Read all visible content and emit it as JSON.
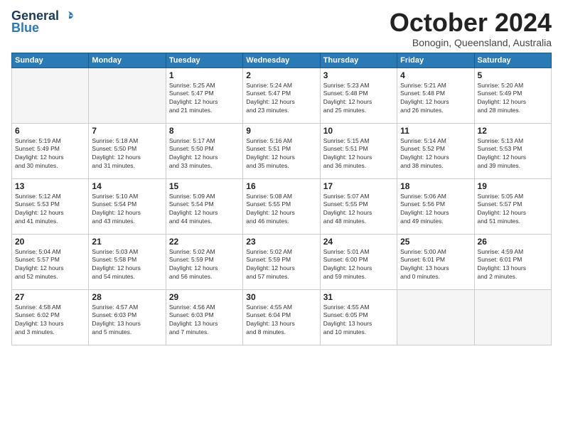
{
  "header": {
    "logo": {
      "general": "General",
      "blue": "Blue"
    },
    "title": "October 2024",
    "location": "Bonogin, Queensland, Australia"
  },
  "weekdays": [
    "Sunday",
    "Monday",
    "Tuesday",
    "Wednesday",
    "Thursday",
    "Friday",
    "Saturday"
  ],
  "weeks": [
    [
      {
        "day": "",
        "info": ""
      },
      {
        "day": "",
        "info": ""
      },
      {
        "day": "1",
        "info": "Sunrise: 5:25 AM\nSunset: 5:47 PM\nDaylight: 12 hours\nand 21 minutes."
      },
      {
        "day": "2",
        "info": "Sunrise: 5:24 AM\nSunset: 5:47 PM\nDaylight: 12 hours\nand 23 minutes."
      },
      {
        "day": "3",
        "info": "Sunrise: 5:23 AM\nSunset: 5:48 PM\nDaylight: 12 hours\nand 25 minutes."
      },
      {
        "day": "4",
        "info": "Sunrise: 5:21 AM\nSunset: 5:48 PM\nDaylight: 12 hours\nand 26 minutes."
      },
      {
        "day": "5",
        "info": "Sunrise: 5:20 AM\nSunset: 5:49 PM\nDaylight: 12 hours\nand 28 minutes."
      }
    ],
    [
      {
        "day": "6",
        "info": "Sunrise: 5:19 AM\nSunset: 5:49 PM\nDaylight: 12 hours\nand 30 minutes."
      },
      {
        "day": "7",
        "info": "Sunrise: 5:18 AM\nSunset: 5:50 PM\nDaylight: 12 hours\nand 31 minutes."
      },
      {
        "day": "8",
        "info": "Sunrise: 5:17 AM\nSunset: 5:50 PM\nDaylight: 12 hours\nand 33 minutes."
      },
      {
        "day": "9",
        "info": "Sunrise: 5:16 AM\nSunset: 5:51 PM\nDaylight: 12 hours\nand 35 minutes."
      },
      {
        "day": "10",
        "info": "Sunrise: 5:15 AM\nSunset: 5:51 PM\nDaylight: 12 hours\nand 36 minutes."
      },
      {
        "day": "11",
        "info": "Sunrise: 5:14 AM\nSunset: 5:52 PM\nDaylight: 12 hours\nand 38 minutes."
      },
      {
        "day": "12",
        "info": "Sunrise: 5:13 AM\nSunset: 5:53 PM\nDaylight: 12 hours\nand 39 minutes."
      }
    ],
    [
      {
        "day": "13",
        "info": "Sunrise: 5:12 AM\nSunset: 5:53 PM\nDaylight: 12 hours\nand 41 minutes."
      },
      {
        "day": "14",
        "info": "Sunrise: 5:10 AM\nSunset: 5:54 PM\nDaylight: 12 hours\nand 43 minutes."
      },
      {
        "day": "15",
        "info": "Sunrise: 5:09 AM\nSunset: 5:54 PM\nDaylight: 12 hours\nand 44 minutes."
      },
      {
        "day": "16",
        "info": "Sunrise: 5:08 AM\nSunset: 5:55 PM\nDaylight: 12 hours\nand 46 minutes."
      },
      {
        "day": "17",
        "info": "Sunrise: 5:07 AM\nSunset: 5:55 PM\nDaylight: 12 hours\nand 48 minutes."
      },
      {
        "day": "18",
        "info": "Sunrise: 5:06 AM\nSunset: 5:56 PM\nDaylight: 12 hours\nand 49 minutes."
      },
      {
        "day": "19",
        "info": "Sunrise: 5:05 AM\nSunset: 5:57 PM\nDaylight: 12 hours\nand 51 minutes."
      }
    ],
    [
      {
        "day": "20",
        "info": "Sunrise: 5:04 AM\nSunset: 5:57 PM\nDaylight: 12 hours\nand 52 minutes."
      },
      {
        "day": "21",
        "info": "Sunrise: 5:03 AM\nSunset: 5:58 PM\nDaylight: 12 hours\nand 54 minutes."
      },
      {
        "day": "22",
        "info": "Sunrise: 5:02 AM\nSunset: 5:59 PM\nDaylight: 12 hours\nand 56 minutes."
      },
      {
        "day": "23",
        "info": "Sunrise: 5:02 AM\nSunset: 5:59 PM\nDaylight: 12 hours\nand 57 minutes."
      },
      {
        "day": "24",
        "info": "Sunrise: 5:01 AM\nSunset: 6:00 PM\nDaylight: 12 hours\nand 59 minutes."
      },
      {
        "day": "25",
        "info": "Sunrise: 5:00 AM\nSunset: 6:01 PM\nDaylight: 13 hours\nand 0 minutes."
      },
      {
        "day": "26",
        "info": "Sunrise: 4:59 AM\nSunset: 6:01 PM\nDaylight: 13 hours\nand 2 minutes."
      }
    ],
    [
      {
        "day": "27",
        "info": "Sunrise: 4:58 AM\nSunset: 6:02 PM\nDaylight: 13 hours\nand 3 minutes."
      },
      {
        "day": "28",
        "info": "Sunrise: 4:57 AM\nSunset: 6:03 PM\nDaylight: 13 hours\nand 5 minutes."
      },
      {
        "day": "29",
        "info": "Sunrise: 4:56 AM\nSunset: 6:03 PM\nDaylight: 13 hours\nand 7 minutes."
      },
      {
        "day": "30",
        "info": "Sunrise: 4:55 AM\nSunset: 6:04 PM\nDaylight: 13 hours\nand 8 minutes."
      },
      {
        "day": "31",
        "info": "Sunrise: 4:55 AM\nSunset: 6:05 PM\nDaylight: 13 hours\nand 10 minutes."
      },
      {
        "day": "",
        "info": ""
      },
      {
        "day": "",
        "info": ""
      }
    ]
  ]
}
